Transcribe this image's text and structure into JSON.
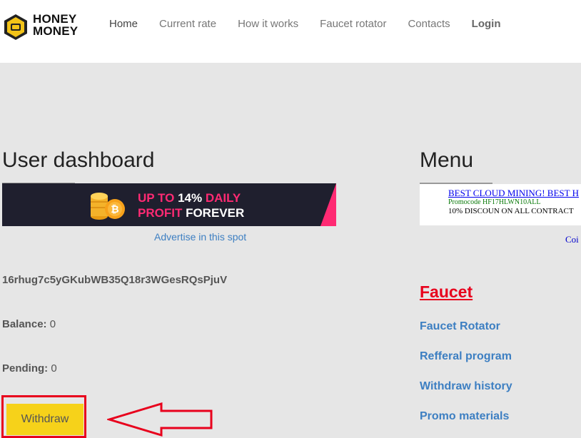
{
  "brand": {
    "line1": "HONEY",
    "line2": "MONEY"
  },
  "nav": {
    "items": [
      {
        "label": "Home"
      },
      {
        "label": "Current rate"
      },
      {
        "label": "How it works"
      },
      {
        "label": "Faucet rotator"
      },
      {
        "label": "Contacts"
      },
      {
        "label": "Login"
      }
    ]
  },
  "dashboard": {
    "title": "User dashboard",
    "banner": {
      "line1_pre": "UP TO ",
      "line1_highlight": "14%",
      "line1_post": " DAILY",
      "line2_pre": "PROFIT",
      "line2_post": " FOREVER"
    },
    "advertise": "Advertise in this spot",
    "wallet_address": "16rhug7c5yGKubWB35Q18r3WGesRQsPjuV",
    "balance_label": "Balance:",
    "balance_value": "0",
    "pending_label": "Pending:",
    "pending_value": "0",
    "withdraw_label": "Withdraw"
  },
  "menu": {
    "title": "Menu",
    "ad": {
      "link": "BEST CLOUD MINING! BEST H",
      "promo": "Promocode HF17HLWN10ALL",
      "discount": "10% DISCOUN  ON ALL CONTRACT"
    },
    "coin_link": "Coi",
    "faucet_title": "Faucet",
    "links": [
      {
        "label": "Faucet Rotator"
      },
      {
        "label": "Refferal program"
      },
      {
        "label": "Withdraw history"
      },
      {
        "label": "Promo materials"
      }
    ]
  },
  "colors": {
    "accent_blue": "#3d7fc2",
    "faucet_red": "#e8001c",
    "withdraw_yellow": "#f6d21a",
    "banner_pink": "#ff2a73"
  }
}
